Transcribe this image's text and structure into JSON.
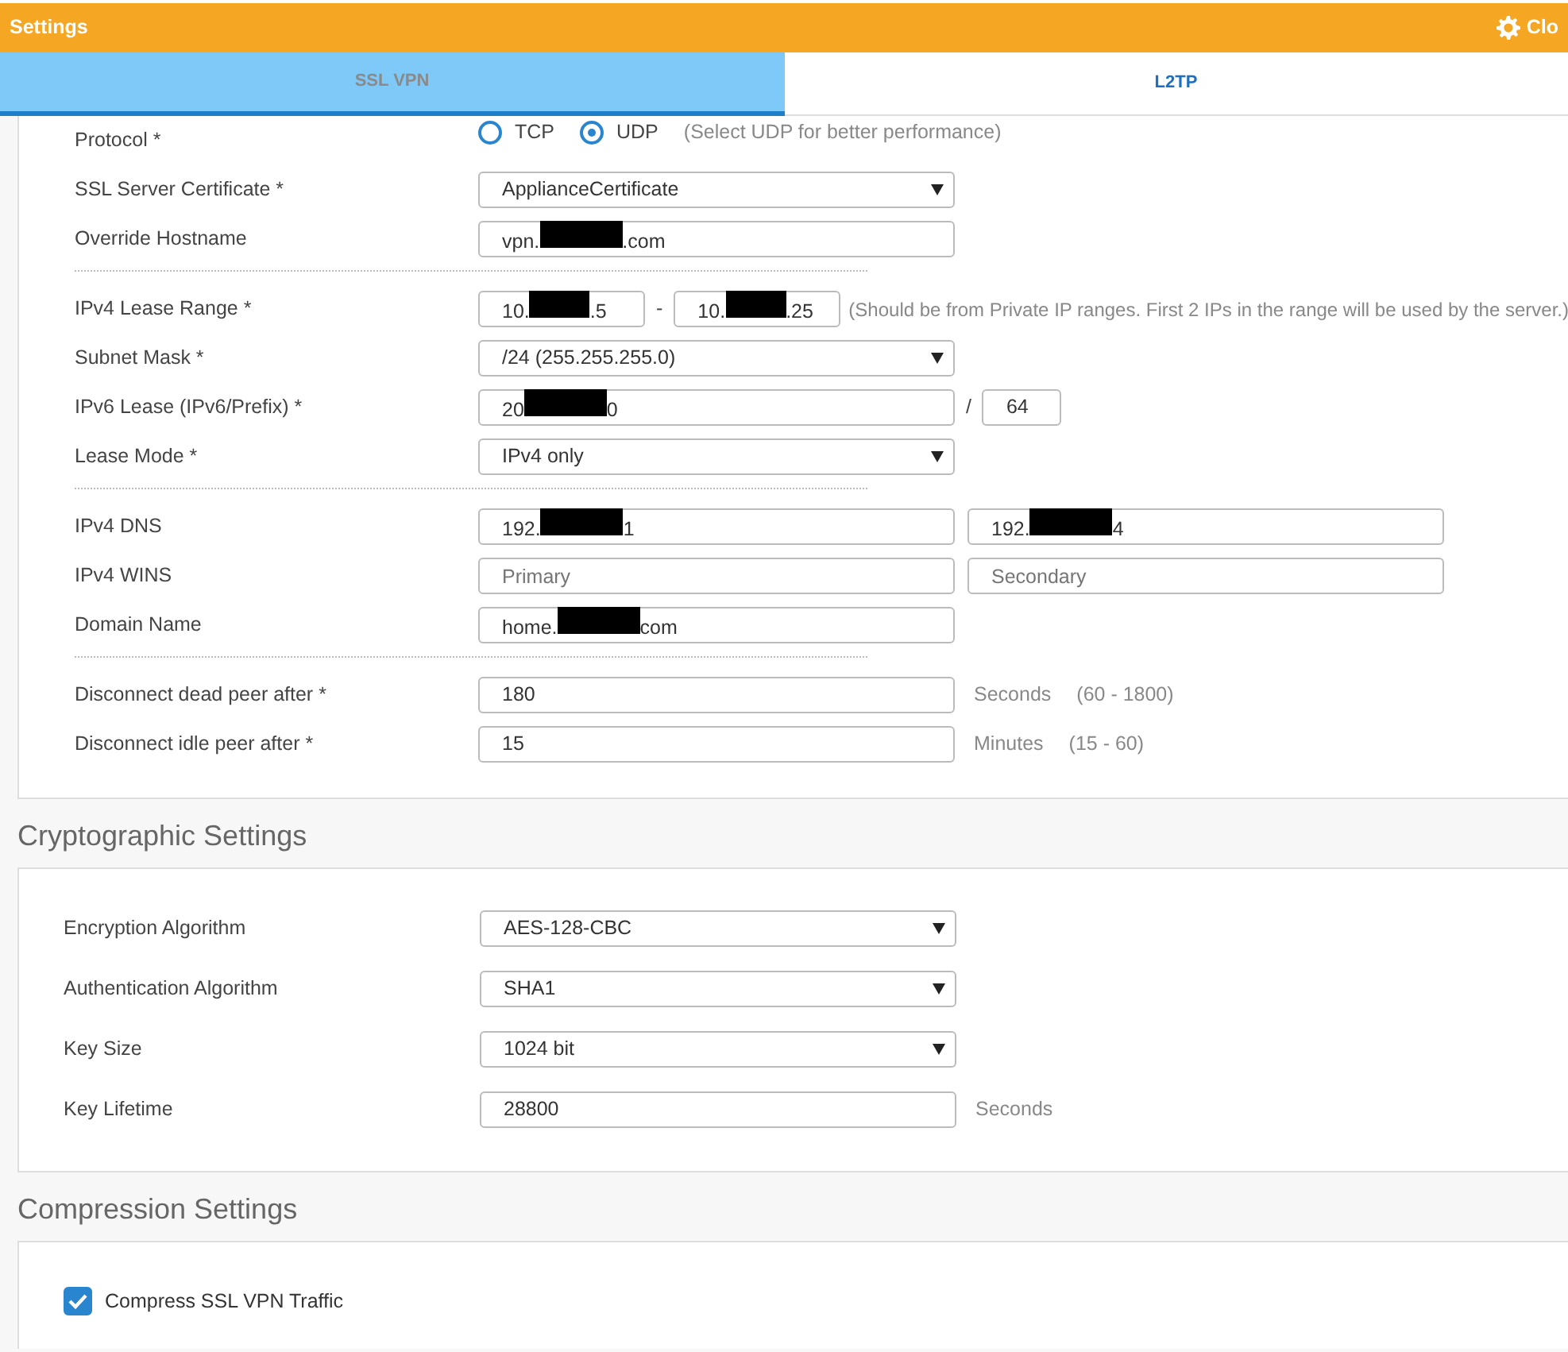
{
  "header": {
    "title": "Settings",
    "close_label": "Clo"
  },
  "tabs": [
    {
      "label": "SSL VPN",
      "selected": true
    },
    {
      "label": "L2TP",
      "selected": false
    }
  ],
  "vpn_settings": {
    "groups": [
      [
        {
          "label": "Protocol *",
          "kind": "radio",
          "options": [
            {
              "label": "TCP",
              "selected": false
            },
            {
              "label": "UDP",
              "selected": true
            }
          ],
          "hint": "(Select UDP for better performance)"
        },
        {
          "label": "SSL Server Certificate *",
          "kind": "select",
          "fields": [
            {
              "value": "ApplianceCertificate"
            }
          ]
        },
        {
          "label": "Override Hostname",
          "kind": "fields",
          "fields": [
            {
              "parts": [
                "vpn.",
                ".com"
              ]
            }
          ]
        }
      ],
      [
        {
          "label": "IPv4 Lease Range *",
          "kind": "range",
          "fields": [
            {
              "parts": [
                "10.",
                ".5"
              ]
            },
            {
              "parts": [
                "10.",
                ".25"
              ]
            }
          ],
          "joiner": "-",
          "hint": "(Should be from Private IP ranges. First 2 IPs in the range will be used by the server.)"
        },
        {
          "label": "Subnet Mask *",
          "kind": "select",
          "fields": [
            {
              "value": "/24 (255.255.255.0)"
            }
          ]
        },
        {
          "label": "IPv6 Lease (IPv6/Prefix) *",
          "kind": "prefix",
          "fields": [
            {
              "parts": [
                "20",
                "0"
              ]
            },
            {
              "value": "64"
            }
          ],
          "joiner": "/"
        },
        {
          "label": "Lease Mode *",
          "kind": "select",
          "fields": [
            {
              "value": "IPv4 only"
            }
          ]
        }
      ],
      [
        {
          "label": "IPv4 DNS",
          "kind": "pair",
          "fields": [
            {
              "parts": [
                "192.",
                "1"
              ]
            },
            {
              "parts": [
                "192.",
                "4"
              ]
            }
          ]
        },
        {
          "label": "IPv4 WINS",
          "kind": "pair",
          "fields": [
            {
              "placeholder": "Primary"
            },
            {
              "placeholder": "Secondary"
            }
          ]
        },
        {
          "label": "Domain Name",
          "kind": "fields",
          "fields": [
            {
              "parts": [
                "home.",
                "com"
              ]
            }
          ]
        }
      ],
      [
        {
          "label": "Disconnect dead peer after *",
          "kind": "fields",
          "fields": [
            {
              "value": "180"
            }
          ],
          "unit": "Seconds",
          "hint": "(60 - 1800)"
        },
        {
          "label": "Disconnect idle peer after *",
          "kind": "fields",
          "fields": [
            {
              "value": "15"
            }
          ],
          "unit": "Minutes",
          "hint": "(15 - 60)"
        }
      ]
    ]
  },
  "cryptographic_settings": {
    "heading": "Cryptographic Settings",
    "rows": [
      {
        "label": "Encryption Algorithm",
        "kind": "select",
        "fields": [
          {
            "value": "AES-128-CBC"
          }
        ]
      },
      {
        "label": "Authentication Algorithm",
        "kind": "select",
        "fields": [
          {
            "value": "SHA1"
          }
        ]
      },
      {
        "label": "Key Size",
        "kind": "select",
        "fields": [
          {
            "value": "1024 bit"
          }
        ]
      },
      {
        "label": "Key Lifetime",
        "kind": "fields",
        "fields": [
          {
            "value": "28800"
          }
        ],
        "unit": "Seconds"
      }
    ]
  },
  "compression_settings": {
    "heading": "Compression Settings",
    "options": [
      {
        "label": "Compress SSL VPN Traffic",
        "checked": true
      }
    ]
  }
}
